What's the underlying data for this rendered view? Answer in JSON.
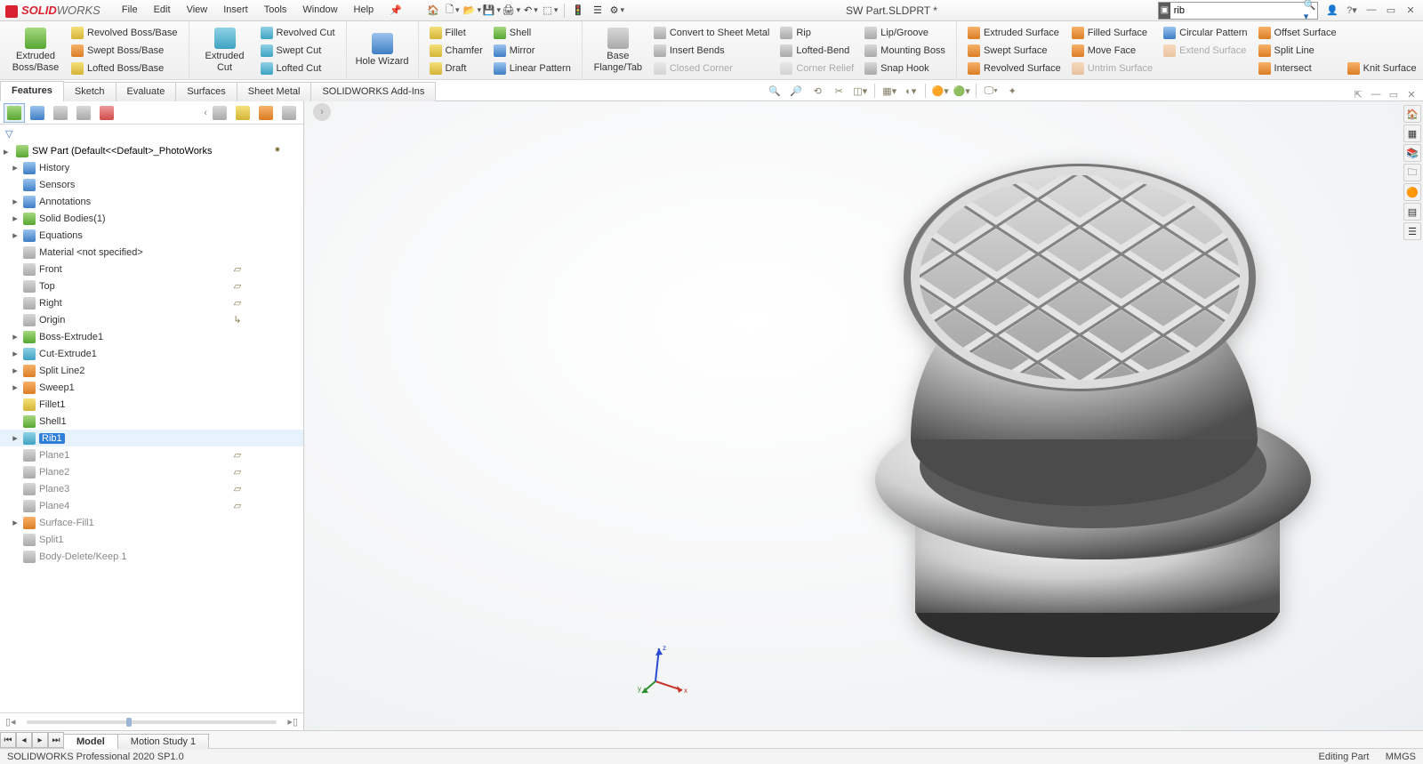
{
  "app": {
    "logo_bold": "SOLID",
    "logo_light": "WORKS"
  },
  "menu": [
    "File",
    "Edit",
    "View",
    "Insert",
    "Tools",
    "Window",
    "Help"
  ],
  "title": "SW Part.SLDPRT *",
  "search": {
    "value": "rib"
  },
  "ribbon": {
    "features": {
      "extrude_boss": "Extruded Boss/Base",
      "revolved_boss": "Revolved Boss/Base",
      "swept_boss": "Swept Boss/Base",
      "lofted_boss": "Lofted Boss/Base",
      "extruded_cut": "Extruded Cut",
      "revolved_cut": "Revolved Cut",
      "swept_cut": "Swept Cut",
      "lofted_cut": "Lofted Cut",
      "hole_wizard": "Hole Wizard",
      "fillet": "Fillet",
      "chamfer": "Chamfer",
      "draft": "Draft",
      "shell": "Shell",
      "mirror": "Mirror",
      "linear_pattern": "Linear Pattern"
    },
    "sheetmetal": {
      "base_flange": "Base Flange/Tab",
      "convert": "Convert to Sheet Metal",
      "insert_bends": "Insert Bends",
      "closed_corner": "Closed Corner",
      "rip": "Rip",
      "lofted_bend": "Lofted-Bend",
      "corner_relief": "Corner Relief",
      "lip_groove": "Lip/Groove",
      "mounting_boss": "Mounting Boss",
      "snap_hook": "Snap Hook"
    },
    "surfaces": {
      "extruded": "Extruded Surface",
      "swept": "Swept Surface",
      "revolved": "Revolved Surface",
      "filled": "Filled Surface",
      "move_face": "Move Face",
      "untrim": "Untrim Surface",
      "circular_pattern": "Circular Pattern",
      "extend": "Extend Surface",
      "offset": "Offset Surface",
      "split_line": "Split Line",
      "intersect": "Intersect",
      "knit": "Knit Surface"
    }
  },
  "tabs": [
    "Features",
    "Sketch",
    "Evaluate",
    "Surfaces",
    "Sheet Metal",
    "SOLIDWORKS Add-Ins"
  ],
  "tree": {
    "root": "SW Part  (Default<<Default>_PhotoWorks",
    "items": [
      {
        "label": "History",
        "icon": "blue",
        "caret": true
      },
      {
        "label": "Sensors",
        "icon": "blue"
      },
      {
        "label": "Annotations",
        "icon": "blue",
        "caret": true
      },
      {
        "label": "Solid Bodies(1)",
        "icon": "green",
        "caret": true
      },
      {
        "label": "Equations",
        "icon": "blue",
        "caret": true
      },
      {
        "label": "Material <not specified>",
        "icon": "grey"
      },
      {
        "label": "Front",
        "icon": "plane",
        "col2": true
      },
      {
        "label": "Top",
        "icon": "plane",
        "col2": true
      },
      {
        "label": "Right",
        "icon": "plane",
        "col2": true
      },
      {
        "label": "Origin",
        "icon": "origin",
        "col2": "axis"
      },
      {
        "label": "Boss-Extrude1",
        "icon": "green",
        "caret": true
      },
      {
        "label": "Cut-Extrude1",
        "icon": "cyan",
        "caret": true
      },
      {
        "label": "Split Line2",
        "icon": "orange",
        "caret": true
      },
      {
        "label": "Sweep1",
        "icon": "orange",
        "caret": true
      },
      {
        "label": "Fillet1",
        "icon": "yellow"
      },
      {
        "label": "Shell1",
        "icon": "green"
      },
      {
        "label": "Rib1",
        "icon": "cyan",
        "caret": true,
        "selected": true
      },
      {
        "label": "Plane1",
        "icon": "plane",
        "dim": true,
        "col2": true
      },
      {
        "label": "Plane2",
        "icon": "plane",
        "dim": true,
        "col2": true
      },
      {
        "label": "Plane3",
        "icon": "plane",
        "dim": true,
        "col2": true
      },
      {
        "label": "Plane4",
        "icon": "plane",
        "dim": true,
        "col2": true
      },
      {
        "label": "Surface-Fill1",
        "icon": "orange",
        "dim": true,
        "caret": true
      },
      {
        "label": "Split1",
        "icon": "grey",
        "dim": true
      },
      {
        "label": "Body-Delete/Keep 1",
        "icon": "grey",
        "dim": true
      }
    ]
  },
  "bottom_tabs": [
    "Model",
    "Motion Study 1"
  ],
  "status": {
    "left": "SOLIDWORKS Professional 2020 SP1.0",
    "right1": "Editing Part",
    "right2": "MMGS"
  },
  "triad": {
    "x": "x",
    "y": "y",
    "z": "z"
  }
}
